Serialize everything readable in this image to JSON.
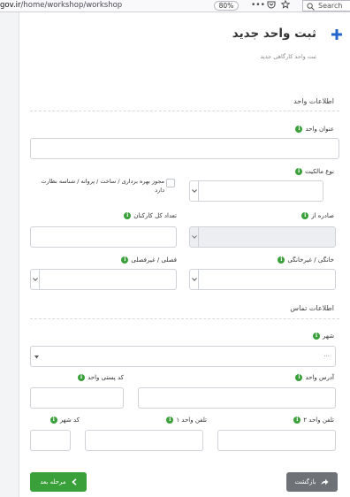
{
  "browser": {
    "url_prefix": "gov.ir",
    "url_path": "/home/workshop/workshop",
    "zoom": "80%",
    "more": "•••",
    "search_placeholder": "Search"
  },
  "page": {
    "title": "ثبت واحد جدید",
    "subtitle": "ثبت واحد کارگاهی جدید"
  },
  "unit_section": {
    "title": "اطلاعات واحد",
    "unit_title_label": "عنوان واحد",
    "ownership_label": "نوع مالکیت",
    "permit_checkbox_label": "مجوز بهره برداری / ساخت / پروانه / شناسه نظارت دارد",
    "issued_from_label": "صادره از",
    "employee_count_label": "تعداد کل کارکنان",
    "household_label": "خانگی / غیرخانگی",
    "seasonal_label": "فصلی / غیرفصلی"
  },
  "contact_section": {
    "title": "اطلاعات تماس",
    "city_label": "شهر",
    "city_value": "...",
    "address_label": "آدرس واحد",
    "postal_code_label": "کد پستی واحد",
    "phone2_label": "تلفن واحد ۲",
    "phone1_label": "تلفن واحد ۱",
    "area_code_label": "کد شهر"
  },
  "buttons": {
    "back_label": "بازگشت",
    "next_label": "مرحله بعد"
  },
  "colors": {
    "accent_blue": "#2266cc",
    "info_green": "#3aa03a",
    "next_green": "#3aa03a",
    "back_gray": "#6e7175"
  }
}
